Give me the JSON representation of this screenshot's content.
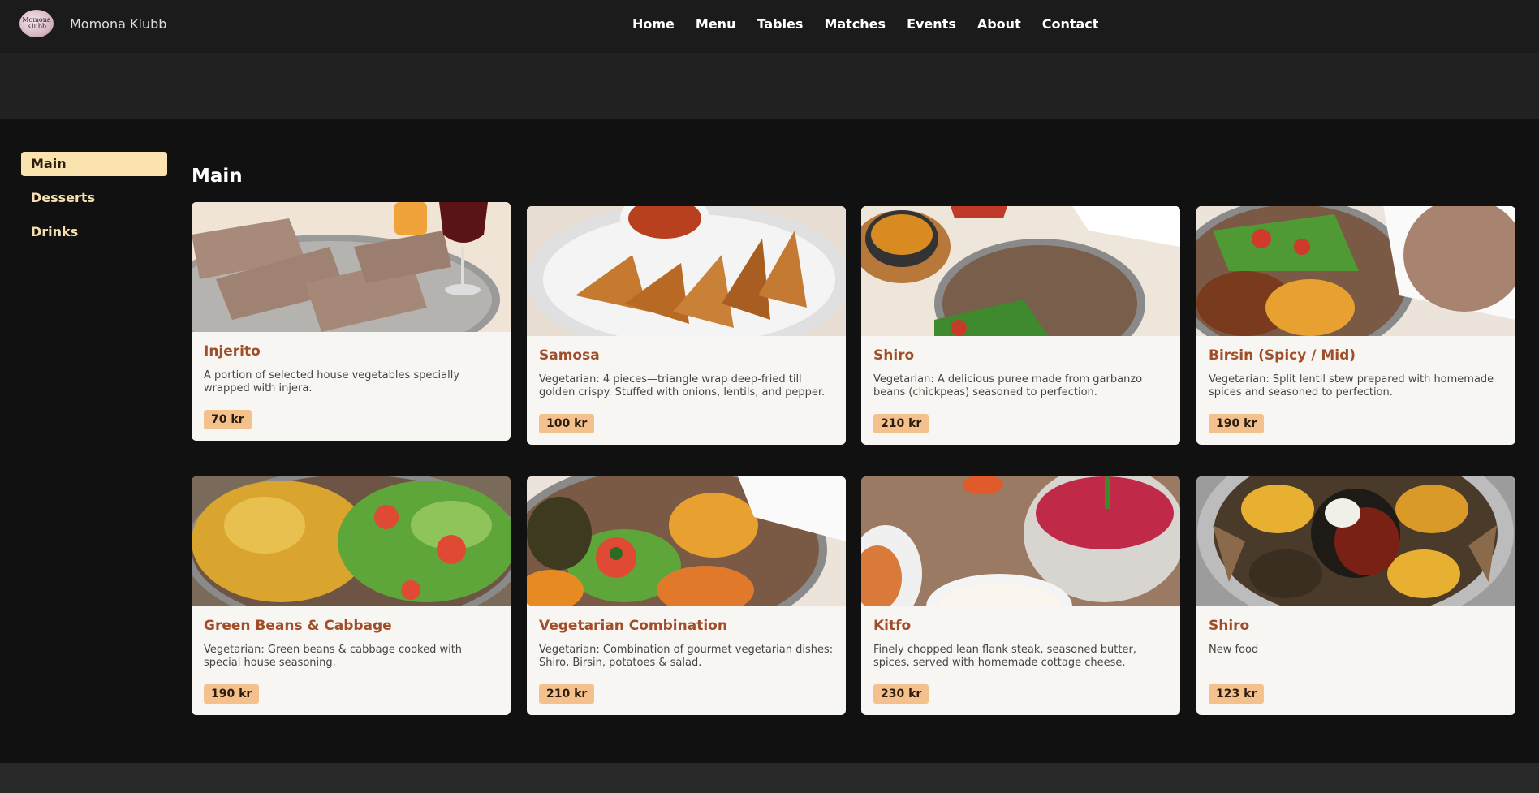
{
  "brand": {
    "logo_text": "Momona Klubb",
    "name": "Momona Klubb"
  },
  "nav": [
    "Home",
    "Menu",
    "Tables",
    "Matches",
    "Events",
    "About",
    "Contact"
  ],
  "sidebar": [
    {
      "label": "Main",
      "active": true
    },
    {
      "label": "Desserts",
      "active": false
    },
    {
      "label": "Drinks",
      "active": false
    }
  ],
  "section_title": "Main",
  "cards": [
    {
      "title": "Injerito",
      "desc": "A portion of selected house vegetables specially wrapped with injera.",
      "price": "70 kr",
      "image": "injera-rolls-with-wine"
    },
    {
      "title": "Samosa",
      "desc": "Vegetarian: 4 pieces—triangle wrap deep-fried till golden crispy. Stuffed with onions, lentils, and pepper.",
      "price": "100 kr",
      "image": "samosa-plate-with-sauce"
    },
    {
      "title": "Shiro",
      "desc": "Vegetarian: A delicious puree made from garbanzo beans (chickpeas) seasoned to perfection.",
      "price": "210 kr",
      "image": "shiro-with-injera"
    },
    {
      "title": "Birsin (Spicy / Mid)",
      "desc": "Vegetarian: Split lentil stew prepared with homemade spices and seasoned to perfection.",
      "price": "190 kr",
      "image": "birsin-with-salad"
    },
    {
      "title": "Green Beans & Cabbage",
      "desc": "Vegetarian: Green beans & cabbage cooked with special house seasoning.",
      "price": "190 kr",
      "image": "cabbage-and-salad"
    },
    {
      "title": "Vegetarian Combination",
      "desc": "Vegetarian: Combination of gourmet vegetarian dishes: Shiro, Birsin, potatoes & salad.",
      "price": "210 kr",
      "image": "vegetarian-combo-platter"
    },
    {
      "title": "Kitfo",
      "desc": "Finely chopped lean flank steak, seasoned butter, spices, served with homemade cottage cheese.",
      "price": "230 kr",
      "image": "kitfo-bowl"
    },
    {
      "title": "Shiro",
      "desc": "New food",
      "price": "123 kr",
      "image": "mixed-platter"
    }
  ]
}
